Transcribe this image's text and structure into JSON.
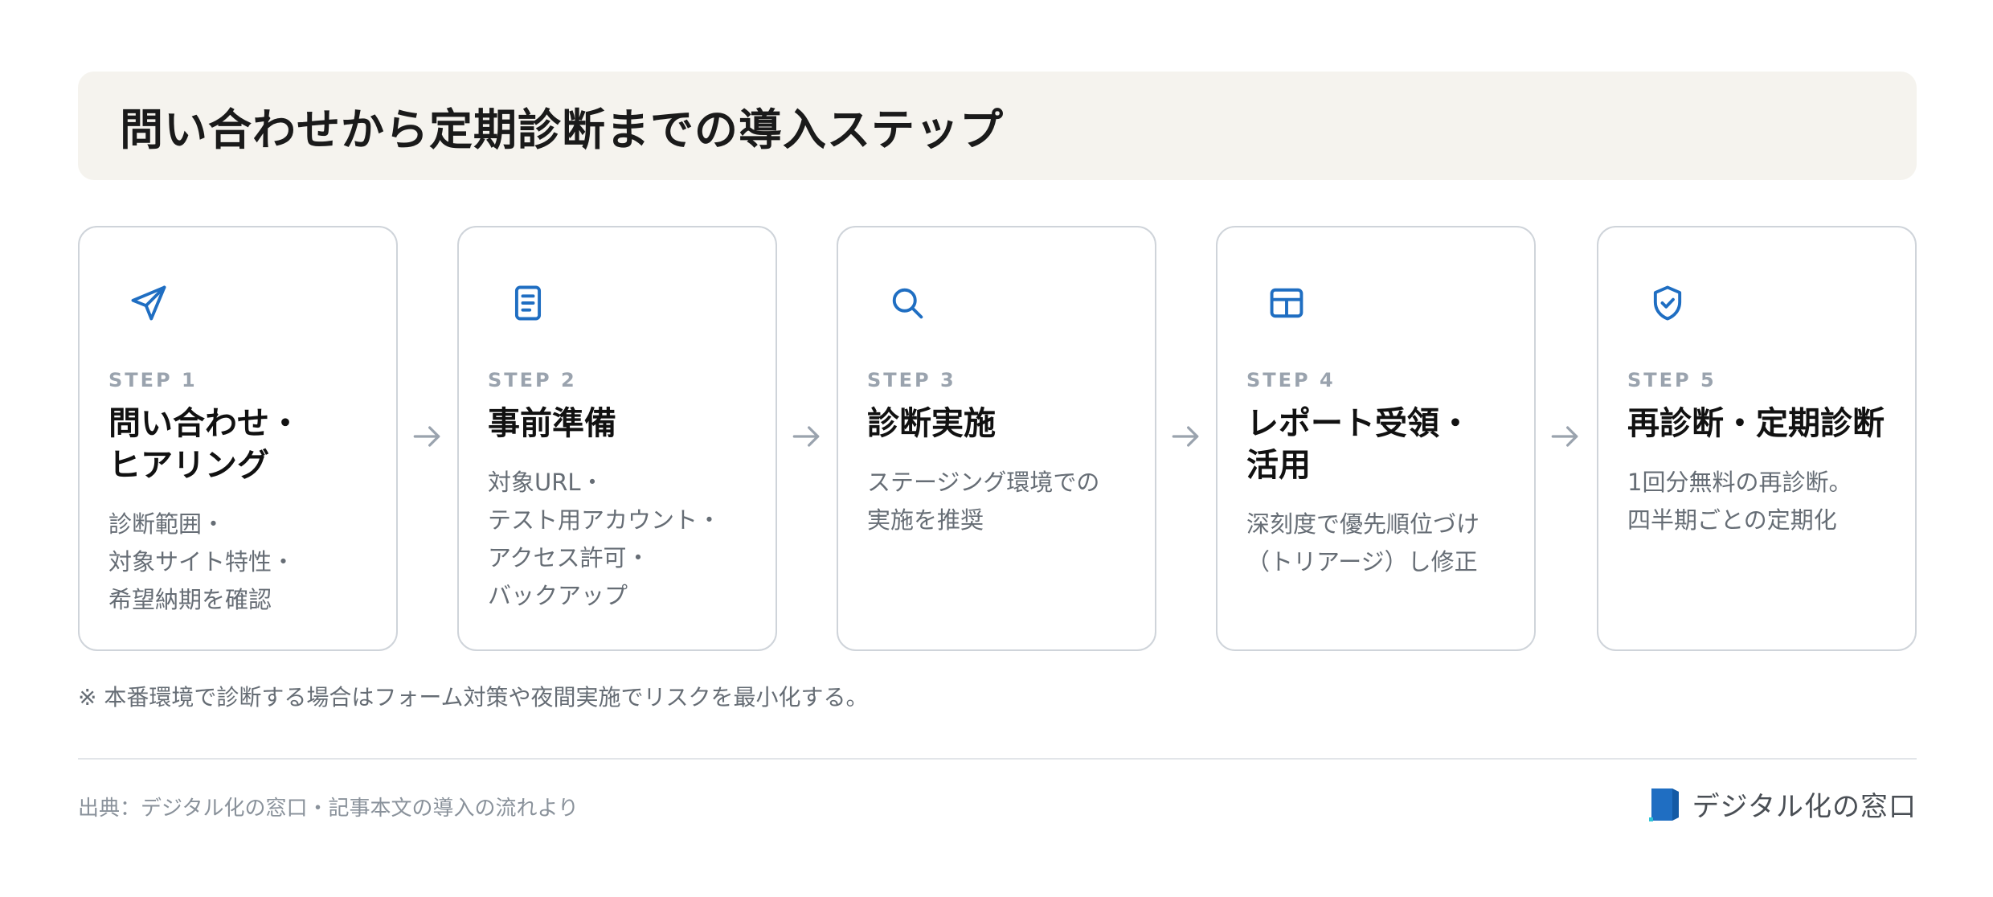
{
  "header": {
    "title": "問い合わせから定期診断までの導入ステップ"
  },
  "steps": [
    {
      "label": "STEP 1",
      "title": "問い合わせ・\nヒアリング",
      "description": "診断範囲・\n対象サイト特性・\n希望納期を確認",
      "icon": "send-icon"
    },
    {
      "label": "STEP 2",
      "title": "事前準備",
      "description": "対象URL・\nテスト用アカウント・\nアクセス許可・\nバックアップ",
      "icon": "document-icon"
    },
    {
      "label": "STEP 3",
      "title": "診断実施",
      "description": "ステージング環境での\n実施を推奨",
      "icon": "search-icon"
    },
    {
      "label": "STEP 4",
      "title": "レポート受領・\n活用",
      "description": "深刻度で優先順位づけ\n（トリアージ）し修正",
      "icon": "table-icon"
    },
    {
      "label": "STEP 5",
      "title": "再診断・定期診断",
      "description": "1回分無料の再診断。\n四半期ごとの定期化",
      "icon": "shield-check-icon"
    }
  ],
  "note": "※ 本番環境で診断する場合はフォーム対策や夜間実施でリスクを最小化する。",
  "footer": {
    "source": "出典：デジタル化の窓口・記事本文の導入の流れより",
    "brand": "デジタル化の窓口"
  },
  "colors": {
    "accent": "#1f6ec2",
    "muted": "#9aa3ae",
    "header_bg": "#f5f3ee",
    "border": "#cfd4da"
  }
}
